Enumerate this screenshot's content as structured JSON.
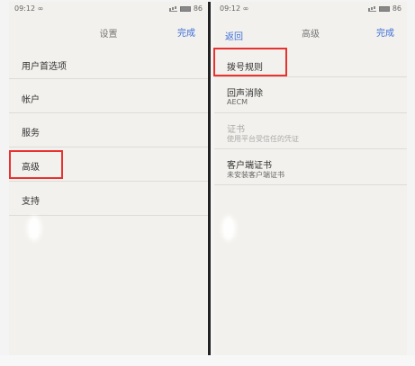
{
  "left_screen": {
    "status": {
      "time": "09:12",
      "indicator": "∞",
      "battery": "86"
    },
    "nav": {
      "title": "设置",
      "done": "完成"
    },
    "items": [
      {
        "label": "用户首选项"
      },
      {
        "label": "帐户"
      },
      {
        "label": "服务"
      },
      {
        "label": "高级"
      },
      {
        "label": "支持"
      }
    ]
  },
  "right_screen": {
    "status": {
      "time": "09:12",
      "indicator": "∞",
      "battery": "86"
    },
    "nav": {
      "back": "返回",
      "title": "高级",
      "done": "完成"
    },
    "items": [
      {
        "label": "拨号规则",
        "sub": ""
      },
      {
        "label": "回声消除",
        "sub": "AECM"
      },
      {
        "label": "证书",
        "sub": "使用平台受信任的凭证"
      },
      {
        "label": "客户端证书",
        "sub": "未安装客户端证书"
      }
    ]
  },
  "colors": {
    "accent": "#3f6fd8",
    "highlight": "#e8322f"
  }
}
